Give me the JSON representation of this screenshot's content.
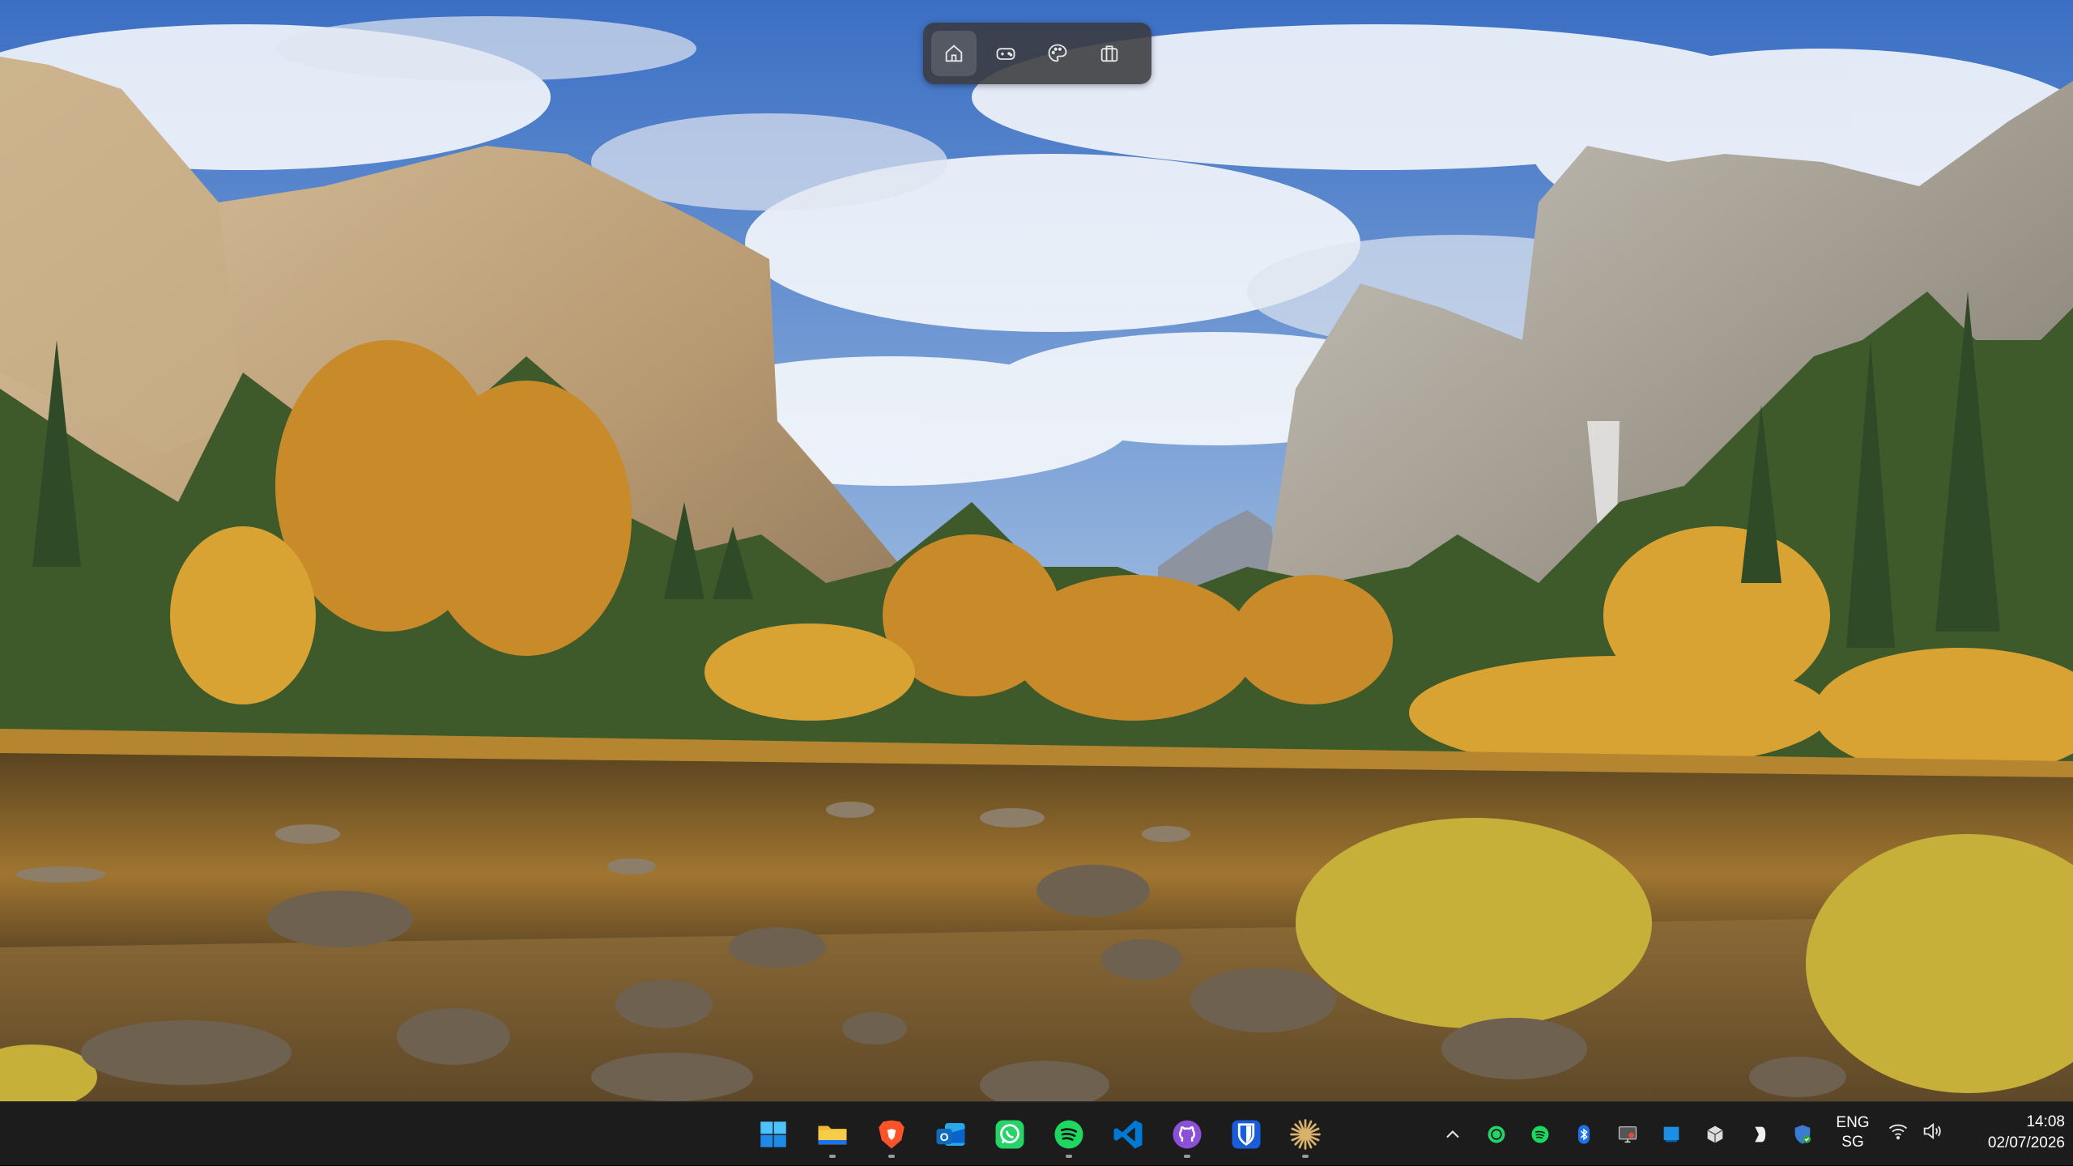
{
  "desktop": {
    "wallpaper_icon": "landscape-wallpaper",
    "switcher": {
      "items": [
        {
          "icon": "home-icon",
          "active": true
        },
        {
          "icon": "gamepad-icon",
          "active": false
        },
        {
          "icon": "palette-icon",
          "active": false
        },
        {
          "icon": "briefcase-icon",
          "active": false
        }
      ]
    }
  },
  "taskbar": {
    "apps": [
      {
        "name": "Start",
        "icon": "windows-logo-icon",
        "running": false
      },
      {
        "name": "File Explorer",
        "icon": "folder-icon",
        "running": true
      },
      {
        "name": "Brave",
        "icon": "brave-icon",
        "running": true
      },
      {
        "name": "Outlook",
        "icon": "outlook-icon",
        "running": false
      },
      {
        "name": "WhatsApp",
        "icon": "whatsapp-icon",
        "running": false
      },
      {
        "name": "Spotify",
        "icon": "spotify-icon",
        "running": true
      },
      {
        "name": "Visual Studio Code",
        "icon": "vscode-icon",
        "running": false
      },
      {
        "name": "GitHub Desktop",
        "icon": "github-icon",
        "running": true
      },
      {
        "name": "Bitwarden",
        "icon": "bitwarden-icon",
        "running": false
      },
      {
        "name": "Starburst app",
        "icon": "starburst-icon",
        "running": true
      }
    ],
    "tray": {
      "icons": [
        "chevron-up-icon",
        "whatsapp-tray-icon",
        "spotify-tray-icon",
        "bluetooth-icon",
        "monitor-tray-icon",
        "windows-square-tray-icon",
        "cube-tray-icon",
        "bracket-tray-icon",
        "defender-tray-icon"
      ],
      "language": "ENG",
      "region": "SG",
      "network_icon": "wifi-icon",
      "volume_icon": "speaker-icon",
      "time": "14:08",
      "date": "02/07/2026"
    },
    "colors": {
      "background": "#1c1c1c",
      "whatsapp": "#25d366",
      "spotify": "#1ed760",
      "vscode": "#0078d4",
      "github": "#8b4fd8",
      "bitwarden": "#175ddc",
      "brave": "#fb542b",
      "folder": "#f2b731"
    }
  }
}
